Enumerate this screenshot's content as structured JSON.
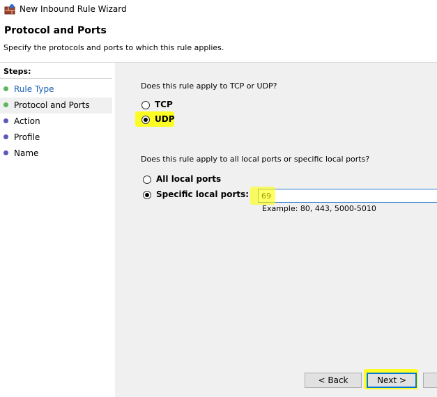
{
  "window": {
    "title": "New Inbound Rule Wizard",
    "app_icon": "firewall-icon"
  },
  "header": {
    "title": "Protocol and Ports",
    "subtitle": "Specify the protocols and ports to which this rule applies."
  },
  "steps": {
    "heading": "Steps:",
    "items": [
      {
        "label": "Rule Type",
        "state": "done"
      },
      {
        "label": "Protocol and Ports",
        "state": "current"
      },
      {
        "label": "Action",
        "state": "pending"
      },
      {
        "label": "Profile",
        "state": "pending"
      },
      {
        "label": "Name",
        "state": "pending"
      }
    ]
  },
  "protocol": {
    "question": "Does this rule apply to TCP or UDP?",
    "options": [
      {
        "label": "TCP",
        "selected": false
      },
      {
        "label": "UDP",
        "selected": true
      }
    ]
  },
  "ports": {
    "question": "Does this rule apply to all local ports or specific local ports?",
    "options": [
      {
        "label": "All local ports",
        "selected": false
      },
      {
        "label": "Specific local ports:",
        "selected": true
      }
    ],
    "value": "69",
    "example": "Example: 80, 443, 5000-5010"
  },
  "buttons": {
    "back": "< Back",
    "next": "Next >"
  },
  "colors": {
    "step_done": "#5cb85c",
    "step_pending": "#5a5ab8",
    "highlight": "#ffff00",
    "accent": "#0078d7"
  }
}
